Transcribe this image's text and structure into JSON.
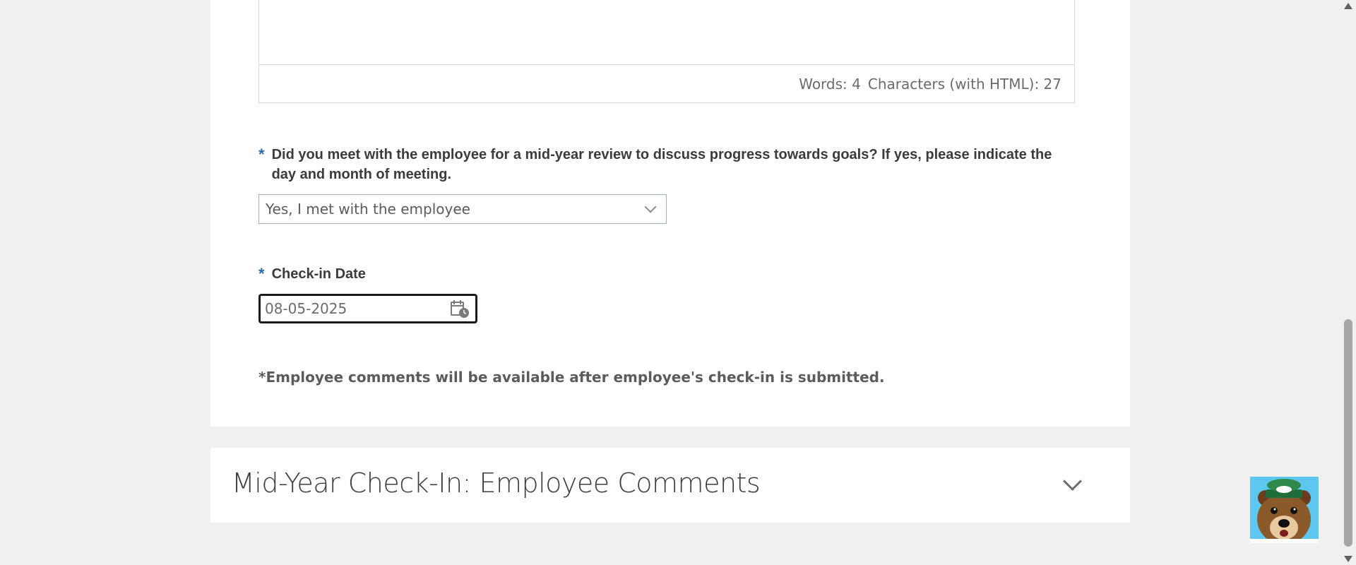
{
  "editor": {
    "words_label": "Words: 4",
    "chars_label": "Characters (with HTML): 27"
  },
  "meeting_question": {
    "required_mark": "*",
    "text": "Did you meet with the employee for a mid-year review to discuss progress towards goals? If yes, please indicate the day and month of meeting.",
    "selected_value": "Yes, I met with the employee",
    "dropdown_icon": "chevron-down-icon"
  },
  "checkin_date": {
    "required_mark": "*",
    "label": "Check-in Date",
    "value": "08-05-2025",
    "icon": "calendar-icon"
  },
  "note": "*Employee comments will be available after employee's check-in is submitted.",
  "section_employee_comments": {
    "title": "Mid-Year Check-In: Employee Comments",
    "toggle_icon": "chevron-down-icon"
  },
  "assistant_avatar": {
    "icon": "bear-mascot-icon"
  },
  "colors": {
    "required_mark": "#2f6ab0",
    "page_background": "#f0f0f0",
    "panel_background": "#ffffff"
  }
}
